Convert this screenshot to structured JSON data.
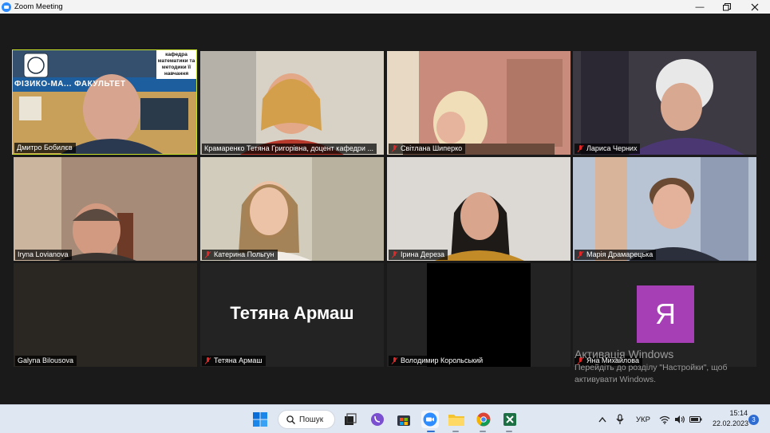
{
  "window": {
    "title": "Zoom Meeting"
  },
  "participants": [
    {
      "name": "Дмитро Бобилєв",
      "muted": false,
      "active": true,
      "sign_text": "кафедра математики та методики її навчання",
      "banner_text": "ФІЗИКО-МА... ФАКУЛЬТЕТ",
      "bg": "#6b7b8c"
    },
    {
      "name": "Крамаренко Тетяна Григорівна, доцент кафедри ...",
      "muted": false,
      "active": false,
      "bg": "#b8b0a8"
    },
    {
      "name": "Світлана Шиперко",
      "muted": true,
      "active": false,
      "bg": "#c98c7c"
    },
    {
      "name": "Лариса Черних",
      "muted": true,
      "active": false,
      "bg": "#3d3a44"
    },
    {
      "name": "Iryna Lovianova",
      "muted": false,
      "active": false,
      "bg": "#8c7466"
    },
    {
      "name": "Катерина Польгун",
      "muted": true,
      "active": false,
      "bg": "#c8c2b0"
    },
    {
      "name": "Ірина Дереза",
      "muted": true,
      "active": false,
      "bg": "#d9d6d2"
    },
    {
      "name": "Марія Драмарецька",
      "muted": true,
      "active": false,
      "bg": "#9aa6b8"
    },
    {
      "name": "Galyna Bilousova",
      "muted": false,
      "active": false,
      "bg": "#2a2723"
    },
    {
      "name": "Тетяна Армаш",
      "muted": true,
      "active": false,
      "display_name": "Тетяна Армаш",
      "bg": "#232323"
    },
    {
      "name": "Володимир  Корольський",
      "muted": true,
      "active": false,
      "bg": "#000000"
    },
    {
      "name": "Яна Михайлова",
      "muted": true,
      "active": false,
      "avatar_letter": "Я",
      "bg": "#232323"
    }
  ],
  "watermark": {
    "line1": "Активація Windows",
    "line2": "Перейдіть до розділу \"Настройки\", щоб",
    "line3": "активувати Windows."
  },
  "taskbar": {
    "search_label": "Пошук",
    "language": "УКР",
    "time": "15:14",
    "date": "22.02.2023",
    "notification_count": "3",
    "apps": [
      "start-icon",
      "search-icon",
      "task-view-icon",
      "viber-icon",
      "store-icon",
      "zoom-icon",
      "file-explorer-icon",
      "chrome-icon",
      "excel-icon"
    ]
  },
  "colors": {
    "active_speaker_border": "#c9e22a",
    "muted_icon": "#e02828",
    "avatar_bg": "#a63fb5",
    "zoom_blue": "#2d8cff"
  }
}
